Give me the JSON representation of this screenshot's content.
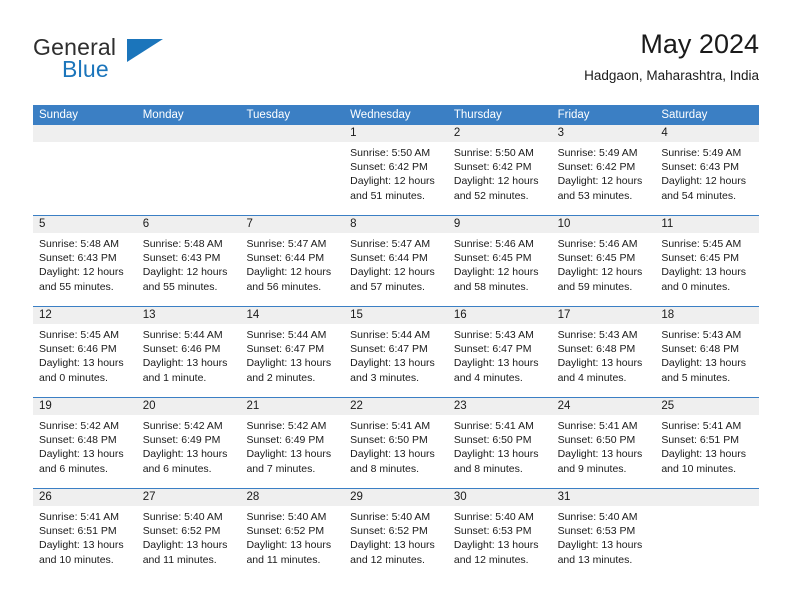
{
  "brand": {
    "name_primary": "General",
    "name_secondary": "Blue",
    "flag_icon": "blue-triangle-flag-icon",
    "accent_color": "#1b75bb"
  },
  "header": {
    "title": "May 2024",
    "subtitle": "Hadgaon, Maharashtra, India"
  },
  "calendar": {
    "header_color": "#3b7fc4",
    "daynum_background": "#efefef",
    "weekdays": [
      "Sunday",
      "Monday",
      "Tuesday",
      "Wednesday",
      "Thursday",
      "Friday",
      "Saturday"
    ],
    "weeks": [
      [
        {
          "day": "",
          "sunrise": "",
          "sunset": "",
          "daylight": "",
          "daylight2": "",
          "empty": true
        },
        {
          "day": "",
          "sunrise": "",
          "sunset": "",
          "daylight": "",
          "daylight2": "",
          "empty": true
        },
        {
          "day": "",
          "sunrise": "",
          "sunset": "",
          "daylight": "",
          "daylight2": "",
          "empty": true
        },
        {
          "day": "1",
          "sunrise": "Sunrise: 5:50 AM",
          "sunset": "Sunset: 6:42 PM",
          "daylight": "Daylight: 12 hours",
          "daylight2": "and 51 minutes.",
          "empty": false
        },
        {
          "day": "2",
          "sunrise": "Sunrise: 5:50 AM",
          "sunset": "Sunset: 6:42 PM",
          "daylight": "Daylight: 12 hours",
          "daylight2": "and 52 minutes.",
          "empty": false
        },
        {
          "day": "3",
          "sunrise": "Sunrise: 5:49 AM",
          "sunset": "Sunset: 6:42 PM",
          "daylight": "Daylight: 12 hours",
          "daylight2": "and 53 minutes.",
          "empty": false
        },
        {
          "day": "4",
          "sunrise": "Sunrise: 5:49 AM",
          "sunset": "Sunset: 6:43 PM",
          "daylight": "Daylight: 12 hours",
          "daylight2": "and 54 minutes.",
          "empty": false
        }
      ],
      [
        {
          "day": "5",
          "sunrise": "Sunrise: 5:48 AM",
          "sunset": "Sunset: 6:43 PM",
          "daylight": "Daylight: 12 hours",
          "daylight2": "and 55 minutes.",
          "empty": false
        },
        {
          "day": "6",
          "sunrise": "Sunrise: 5:48 AM",
          "sunset": "Sunset: 6:43 PM",
          "daylight": "Daylight: 12 hours",
          "daylight2": "and 55 minutes.",
          "empty": false
        },
        {
          "day": "7",
          "sunrise": "Sunrise: 5:47 AM",
          "sunset": "Sunset: 6:44 PM",
          "daylight": "Daylight: 12 hours",
          "daylight2": "and 56 minutes.",
          "empty": false
        },
        {
          "day": "8",
          "sunrise": "Sunrise: 5:47 AM",
          "sunset": "Sunset: 6:44 PM",
          "daylight": "Daylight: 12 hours",
          "daylight2": "and 57 minutes.",
          "empty": false
        },
        {
          "day": "9",
          "sunrise": "Sunrise: 5:46 AM",
          "sunset": "Sunset: 6:45 PM",
          "daylight": "Daylight: 12 hours",
          "daylight2": "and 58 minutes.",
          "empty": false
        },
        {
          "day": "10",
          "sunrise": "Sunrise: 5:46 AM",
          "sunset": "Sunset: 6:45 PM",
          "daylight": "Daylight: 12 hours",
          "daylight2": "and 59 minutes.",
          "empty": false
        },
        {
          "day": "11",
          "sunrise": "Sunrise: 5:45 AM",
          "sunset": "Sunset: 6:45 PM",
          "daylight": "Daylight: 13 hours",
          "daylight2": "and 0 minutes.",
          "empty": false
        }
      ],
      [
        {
          "day": "12",
          "sunrise": "Sunrise: 5:45 AM",
          "sunset": "Sunset: 6:46 PM",
          "daylight": "Daylight: 13 hours",
          "daylight2": "and 0 minutes.",
          "empty": false
        },
        {
          "day": "13",
          "sunrise": "Sunrise: 5:44 AM",
          "sunset": "Sunset: 6:46 PM",
          "daylight": "Daylight: 13 hours",
          "daylight2": "and 1 minute.",
          "empty": false
        },
        {
          "day": "14",
          "sunrise": "Sunrise: 5:44 AM",
          "sunset": "Sunset: 6:47 PM",
          "daylight": "Daylight: 13 hours",
          "daylight2": "and 2 minutes.",
          "empty": false
        },
        {
          "day": "15",
          "sunrise": "Sunrise: 5:44 AM",
          "sunset": "Sunset: 6:47 PM",
          "daylight": "Daylight: 13 hours",
          "daylight2": "and 3 minutes.",
          "empty": false
        },
        {
          "day": "16",
          "sunrise": "Sunrise: 5:43 AM",
          "sunset": "Sunset: 6:47 PM",
          "daylight": "Daylight: 13 hours",
          "daylight2": "and 4 minutes.",
          "empty": false
        },
        {
          "day": "17",
          "sunrise": "Sunrise: 5:43 AM",
          "sunset": "Sunset: 6:48 PM",
          "daylight": "Daylight: 13 hours",
          "daylight2": "and 4 minutes.",
          "empty": false
        },
        {
          "day": "18",
          "sunrise": "Sunrise: 5:43 AM",
          "sunset": "Sunset: 6:48 PM",
          "daylight": "Daylight: 13 hours",
          "daylight2": "and 5 minutes.",
          "empty": false
        }
      ],
      [
        {
          "day": "19",
          "sunrise": "Sunrise: 5:42 AM",
          "sunset": "Sunset: 6:48 PM",
          "daylight": "Daylight: 13 hours",
          "daylight2": "and 6 minutes.",
          "empty": false
        },
        {
          "day": "20",
          "sunrise": "Sunrise: 5:42 AM",
          "sunset": "Sunset: 6:49 PM",
          "daylight": "Daylight: 13 hours",
          "daylight2": "and 6 minutes.",
          "empty": false
        },
        {
          "day": "21",
          "sunrise": "Sunrise: 5:42 AM",
          "sunset": "Sunset: 6:49 PM",
          "daylight": "Daylight: 13 hours",
          "daylight2": "and 7 minutes.",
          "empty": false
        },
        {
          "day": "22",
          "sunrise": "Sunrise: 5:41 AM",
          "sunset": "Sunset: 6:50 PM",
          "daylight": "Daylight: 13 hours",
          "daylight2": "and 8 minutes.",
          "empty": false
        },
        {
          "day": "23",
          "sunrise": "Sunrise: 5:41 AM",
          "sunset": "Sunset: 6:50 PM",
          "daylight": "Daylight: 13 hours",
          "daylight2": "and 8 minutes.",
          "empty": false
        },
        {
          "day": "24",
          "sunrise": "Sunrise: 5:41 AM",
          "sunset": "Sunset: 6:50 PM",
          "daylight": "Daylight: 13 hours",
          "daylight2": "and 9 minutes.",
          "empty": false
        },
        {
          "day": "25",
          "sunrise": "Sunrise: 5:41 AM",
          "sunset": "Sunset: 6:51 PM",
          "daylight": "Daylight: 13 hours",
          "daylight2": "and 10 minutes.",
          "empty": false
        }
      ],
      [
        {
          "day": "26",
          "sunrise": "Sunrise: 5:41 AM",
          "sunset": "Sunset: 6:51 PM",
          "daylight": "Daylight: 13 hours",
          "daylight2": "and 10 minutes.",
          "empty": false
        },
        {
          "day": "27",
          "sunrise": "Sunrise: 5:40 AM",
          "sunset": "Sunset: 6:52 PM",
          "daylight": "Daylight: 13 hours",
          "daylight2": "and 11 minutes.",
          "empty": false
        },
        {
          "day": "28",
          "sunrise": "Sunrise: 5:40 AM",
          "sunset": "Sunset: 6:52 PM",
          "daylight": "Daylight: 13 hours",
          "daylight2": "and 11 minutes.",
          "empty": false
        },
        {
          "day": "29",
          "sunrise": "Sunrise: 5:40 AM",
          "sunset": "Sunset: 6:52 PM",
          "daylight": "Daylight: 13 hours",
          "daylight2": "and 12 minutes.",
          "empty": false
        },
        {
          "day": "30",
          "sunrise": "Sunrise: 5:40 AM",
          "sunset": "Sunset: 6:53 PM",
          "daylight": "Daylight: 13 hours",
          "daylight2": "and 12 minutes.",
          "empty": false
        },
        {
          "day": "31",
          "sunrise": "Sunrise: 5:40 AM",
          "sunset": "Sunset: 6:53 PM",
          "daylight": "Daylight: 13 hours",
          "daylight2": "and 13 minutes.",
          "empty": false
        },
        {
          "day": "",
          "sunrise": "",
          "sunset": "",
          "daylight": "",
          "daylight2": "",
          "empty": true
        }
      ]
    ]
  }
}
